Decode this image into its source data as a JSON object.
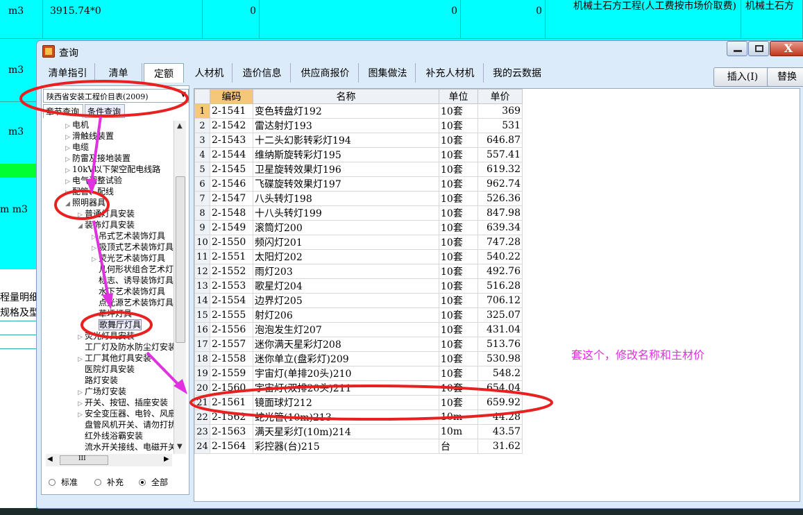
{
  "background": {
    "top_row": {
      "unit": "m3",
      "expr": "3915.74*0",
      "v1": "0",
      "v2": "0",
      "v3": "0",
      "desc1": "机械土石方工程(人工费按市场价取费)",
      "desc2": "机械土石方"
    },
    "units": [
      "m3",
      "m3",
      "m m3"
    ],
    "side_labels": [
      "程量明细",
      "规格及型"
    ]
  },
  "dialog": {
    "title": "查询",
    "close_glyph": "X",
    "tabs": [
      "清单指引",
      "清单",
      "定额",
      "人材机",
      "造价信息",
      "供应商报价",
      "图集做法",
      "补充人材机",
      "我的云数据"
    ],
    "insert_button": "插入(I)",
    "replace_button": "替换"
  },
  "left": {
    "catalog": "陕西省安装工程价目表(2009)",
    "subtabs": [
      "章节查询",
      "条件查询"
    ],
    "tree": [
      {
        "label": "电机",
        "depth": 1,
        "tw": "▷"
      },
      {
        "label": "滑触线装置",
        "depth": 1,
        "tw": "▷"
      },
      {
        "label": "电缆",
        "depth": 1,
        "tw": "▷"
      },
      {
        "label": "防雷及接地装置",
        "depth": 1,
        "tw": "▷"
      },
      {
        "label": "10kV以下架空配电线路",
        "depth": 1,
        "tw": "▷"
      },
      {
        "label": "电气调整试验",
        "depth": 1,
        "tw": "▷"
      },
      {
        "label": "配管、配线",
        "depth": 1,
        "tw": "▷"
      },
      {
        "label": "照明器具",
        "depth": 1,
        "tw": "◢"
      },
      {
        "label": "普通灯具安装",
        "depth": 2,
        "tw": "▷"
      },
      {
        "label": "装饰灯具安装",
        "depth": 2,
        "tw": "◢"
      },
      {
        "label": "吊式艺术装饰灯具",
        "depth": 3,
        "tw": "▷"
      },
      {
        "label": "吸顶式艺术装饰灯具",
        "depth": 3,
        "tw": "▷"
      },
      {
        "label": "荧光艺术装饰灯具",
        "depth": 3,
        "tw": "▷"
      },
      {
        "label": "几何形状组合艺术灯",
        "depth": 3,
        "tw": ""
      },
      {
        "label": "标志、诱导装饰灯具",
        "depth": 3,
        "tw": ""
      },
      {
        "label": "水下艺术装饰灯具",
        "depth": 3,
        "tw": ""
      },
      {
        "label": "点光源艺术装饰灯具",
        "depth": 3,
        "tw": ""
      },
      {
        "label": "草坪灯具",
        "depth": 3,
        "tw": ""
      },
      {
        "label": "歌舞厅灯具",
        "depth": 3,
        "tw": "",
        "selected": true
      },
      {
        "label": "荧光灯具安装",
        "depth": 2,
        "tw": "▷"
      },
      {
        "label": "工厂灯及防水防尘灯安装",
        "depth": 2,
        "tw": ""
      },
      {
        "label": "工厂其他灯具安装",
        "depth": 2,
        "tw": "▷"
      },
      {
        "label": "医院灯具安装",
        "depth": 2,
        "tw": ""
      },
      {
        "label": "路灯安装",
        "depth": 2,
        "tw": ""
      },
      {
        "label": "广场灯安装",
        "depth": 2,
        "tw": "▷"
      },
      {
        "label": "开关、按钮、插座安装",
        "depth": 2,
        "tw": "▷"
      },
      {
        "label": "安全变压器、电铃、风扇",
        "depth": 2,
        "tw": "▷"
      },
      {
        "label": "盘管风机开关、请勿打扰",
        "depth": 2,
        "tw": ""
      },
      {
        "label": "红外线浴霸安装",
        "depth": 2,
        "tw": ""
      },
      {
        "label": "流水开关接线、电磁开关",
        "depth": 2,
        "tw": ""
      }
    ],
    "scroll_glyph": "III",
    "radios": [
      {
        "label": "标准",
        "on": false
      },
      {
        "label": "补充",
        "on": false
      },
      {
        "label": "全部",
        "on": true
      }
    ]
  },
  "table": {
    "headers": [
      "编码",
      "名称",
      "单位",
      "单价"
    ],
    "rows": [
      [
        "1",
        "2-1541",
        "变色转盘灯192",
        "10套",
        "369"
      ],
      [
        "2",
        "2-1542",
        "雷达射灯193",
        "10套",
        "531"
      ],
      [
        "3",
        "2-1543",
        "十二头幻影转彩灯194",
        "10套",
        "646.87"
      ],
      [
        "4",
        "2-1544",
        "维纳斯旋转彩灯195",
        "10套",
        "557.41"
      ],
      [
        "5",
        "2-1545",
        "卫星旋转效果灯196",
        "10套",
        "619.32"
      ],
      [
        "6",
        "2-1546",
        "飞碟旋转效果灯197",
        "10套",
        "962.74"
      ],
      [
        "7",
        "2-1547",
        "八头转灯198",
        "10套",
        "526.36"
      ],
      [
        "8",
        "2-1548",
        "十八头转灯199",
        "10套",
        "847.98"
      ],
      [
        "9",
        "2-1549",
        "滚筒灯200",
        "10套",
        "639.34"
      ],
      [
        "10",
        "2-1550",
        "频闪灯201",
        "10套",
        "747.28"
      ],
      [
        "11",
        "2-1551",
        "太阳灯202",
        "10套",
        "540.22"
      ],
      [
        "12",
        "2-1552",
        "雨灯203",
        "10套",
        "492.76"
      ],
      [
        "13",
        "2-1553",
        "歌星灯204",
        "10套",
        "516.28"
      ],
      [
        "14",
        "2-1554",
        "边界灯205",
        "10套",
        "706.12"
      ],
      [
        "15",
        "2-1555",
        "射灯206",
        "10套",
        "325.07"
      ],
      [
        "16",
        "2-1556",
        "泡泡发生灯207",
        "10套",
        "431.04"
      ],
      [
        "17",
        "2-1557",
        "迷你满天星彩灯208",
        "10套",
        "513.76"
      ],
      [
        "18",
        "2-1558",
        "迷你单立(盘彩灯)209",
        "10套",
        "530.98"
      ],
      [
        "19",
        "2-1559",
        "宇宙灯(单排20头)210",
        "10套",
        "548.2"
      ],
      [
        "20",
        "2-1560",
        "宇宙灯(双排20头)211",
        "10套",
        "654.04"
      ],
      [
        "21",
        "2-1561",
        "镜面球灯212",
        "10套",
        "659.92"
      ],
      [
        "22",
        "2-1562",
        "蛇光管(10m)213",
        "10m",
        "44.28"
      ],
      [
        "23",
        "2-1563",
        "满天星彩灯(10m)214",
        "10m",
        "43.57"
      ],
      [
        "24",
        "2-1564",
        "彩控器(台)215",
        "台",
        "31.62"
      ]
    ]
  },
  "annotation": {
    "note": "套这个，修改名称和主材价",
    "color": "#e030e0",
    "ellipse_color": "#e82020"
  }
}
